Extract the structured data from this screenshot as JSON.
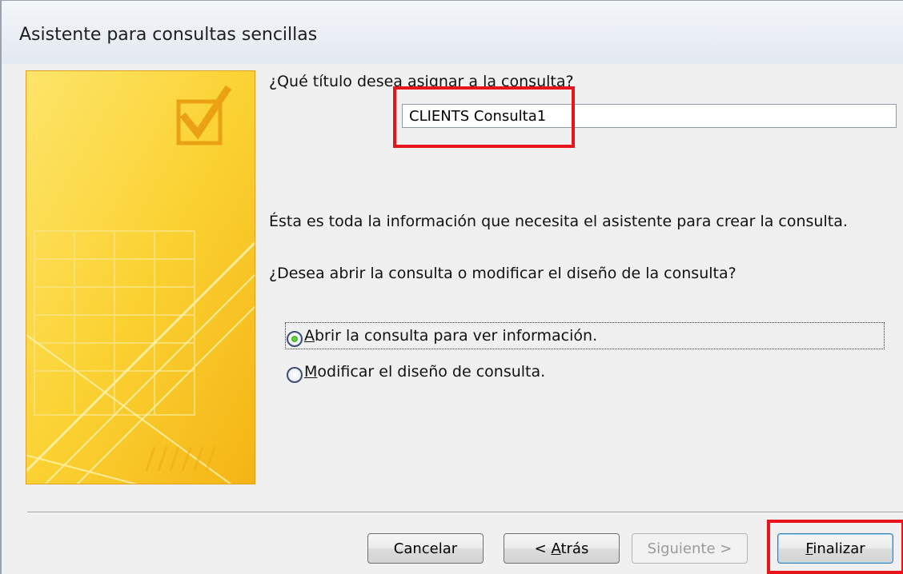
{
  "window": {
    "title": "Asistente para consultas sencillas"
  },
  "form": {
    "question_title": "¿Qué título desea asignar a la consulta?",
    "title_value": "CLIENTS Consulta1",
    "info_text": "Ésta es toda la información que necesita el asistente para crear la consulta.",
    "question_open": "¿Desea abrir la consulta o modificar el diseño de la consulta?"
  },
  "options": [
    {
      "first": "A",
      "rest": "brir la consulta para ver información.",
      "selected": true
    },
    {
      "first": "M",
      "rest": "odificar el diseño de consulta.",
      "selected": false
    }
  ],
  "buttons": {
    "cancel": "Cancelar",
    "back_prefix": "< ",
    "back_first": "A",
    "back_rest": "trás",
    "next": "Siguiente >",
    "finish_first": "F",
    "finish_rest": "inalizar"
  },
  "colors": {
    "highlight": "#e8141b",
    "accent": "#f7c31a"
  }
}
